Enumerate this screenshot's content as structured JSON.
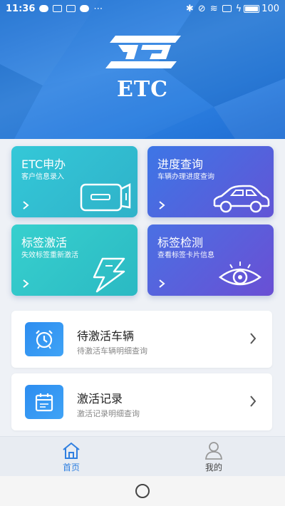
{
  "status_bar": {
    "time": "11:36",
    "battery": "100"
  },
  "header": {
    "logo_icon": "etc-logo-icon",
    "title": "ETC"
  },
  "cards": [
    {
      "title": "ETC申办",
      "subtitle": "客户信息录入",
      "icon": "etc-card-reader-icon"
    },
    {
      "title": "进度查询",
      "subtitle": "车辆办理进度查询",
      "icon": "car-icon"
    },
    {
      "title": "标签激活",
      "subtitle": "失效标签重新激活",
      "icon": "lightning-icon"
    },
    {
      "title": "标签检测",
      "subtitle": "查看标签卡片信息",
      "icon": "eye-icon"
    }
  ],
  "list": [
    {
      "title": "待激活车辆",
      "subtitle": "待激活车辆明细查询",
      "icon": "alarm-clock-icon"
    },
    {
      "title": "激活记录",
      "subtitle": "激活记录明细查询",
      "icon": "calendar-icon"
    }
  ],
  "tabbar": {
    "home_label": "首页",
    "mine_label": "我的",
    "active": "home"
  },
  "colors": {
    "header_blue": "#2c7fe0",
    "card_teal": "#34c8d8",
    "card_purple": "#6255d6",
    "accent": "#2f7fe0"
  }
}
